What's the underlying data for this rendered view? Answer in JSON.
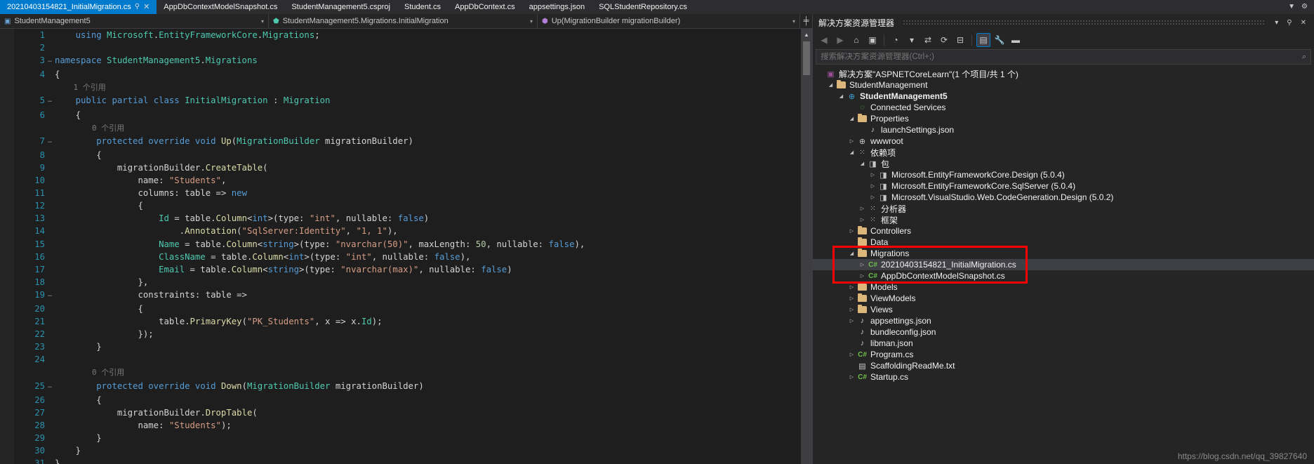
{
  "tabs": [
    {
      "label": "20210403154821_InitialMigration.cs",
      "active": true,
      "pin": "⚲",
      "close": "✕"
    },
    {
      "label": "AppDbContextModelSnapshot.cs",
      "active": false
    },
    {
      "label": "StudentManagement5.csproj",
      "active": false
    },
    {
      "label": "Student.cs",
      "active": false
    },
    {
      "label": "AppDbContext.cs",
      "active": false
    },
    {
      "label": "appsettings.json",
      "active": false
    },
    {
      "label": "SQLStudentRepository.cs",
      "active": false
    }
  ],
  "tab_controls": {
    "dropdown": "▼",
    "gear": "⚙"
  },
  "navbar": {
    "project": "StudentManagement5",
    "type": "StudentManagement5.Migrations.InitialMigration",
    "member": "Up(MigrationBuilder migrationBuilder)",
    "caret": "▾",
    "split": "╪"
  },
  "editor": {
    "scroll": {
      "up": "▲",
      "down": "▼"
    },
    "lines": [
      {
        "n": "1",
        "fold": "",
        "text": "    using Microsoft.EntityFrameworkCore.Migrations;"
      },
      {
        "n": "2",
        "fold": "",
        "text": ""
      },
      {
        "n": "3",
        "fold": "−",
        "text": "namespace StudentManagement5.Migrations"
      },
      {
        "n": "4",
        "fold": "",
        "text": "{"
      },
      {
        "n": "",
        "fold": "",
        "text": "    1 个引用"
      },
      {
        "n": "5",
        "fold": "−",
        "text": "    public partial class InitialMigration : Migration"
      },
      {
        "n": "6",
        "fold": "",
        "text": "    {"
      },
      {
        "n": "",
        "fold": "",
        "text": "        0 个引用"
      },
      {
        "n": "7",
        "fold": "−",
        "text": "        protected override void Up(MigrationBuilder migrationBuilder)"
      },
      {
        "n": "8",
        "fold": "",
        "text": "        {"
      },
      {
        "n": "9",
        "fold": "",
        "text": "            migrationBuilder.CreateTable("
      },
      {
        "n": "10",
        "fold": "",
        "text": "                name: \"Students\","
      },
      {
        "n": "11",
        "fold": "",
        "text": "                columns: table => new"
      },
      {
        "n": "12",
        "fold": "",
        "text": "                {"
      },
      {
        "n": "13",
        "fold": "",
        "text": "                    Id = table.Column<int>(type: \"int\", nullable: false)"
      },
      {
        "n": "14",
        "fold": "",
        "text": "                        .Annotation(\"SqlServer:Identity\", \"1, 1\"),"
      },
      {
        "n": "15",
        "fold": "",
        "text": "                    Name = table.Column<string>(type: \"nvarchar(50)\", maxLength: 50, nullable: false),"
      },
      {
        "n": "16",
        "fold": "",
        "text": "                    ClassName = table.Column<int>(type: \"int\", nullable: false),"
      },
      {
        "n": "17",
        "fold": "",
        "text": "                    Email = table.Column<string>(type: \"nvarchar(max)\", nullable: false)"
      },
      {
        "n": "18",
        "fold": "",
        "text": "                },"
      },
      {
        "n": "19",
        "fold": "−",
        "text": "                constraints: table =>"
      },
      {
        "n": "20",
        "fold": "",
        "text": "                {"
      },
      {
        "n": "21",
        "fold": "",
        "text": "                    table.PrimaryKey(\"PK_Students\", x => x.Id);"
      },
      {
        "n": "22",
        "fold": "",
        "text": "                });"
      },
      {
        "n": "23",
        "fold": "",
        "text": "        }"
      },
      {
        "n": "24",
        "fold": "",
        "text": ""
      },
      {
        "n": "",
        "fold": "",
        "text": "        0 个引用"
      },
      {
        "n": "25",
        "fold": "−",
        "text": "        protected override void Down(MigrationBuilder migrationBuilder)"
      },
      {
        "n": "26",
        "fold": "",
        "text": "        {"
      },
      {
        "n": "27",
        "fold": "",
        "text": "            migrationBuilder.DropTable("
      },
      {
        "n": "28",
        "fold": "",
        "text": "                name: \"Students\");"
      },
      {
        "n": "29",
        "fold": "",
        "text": "        }"
      },
      {
        "n": "30",
        "fold": "",
        "text": "    }"
      },
      {
        "n": "31",
        "fold": "",
        "text": "}"
      }
    ]
  },
  "solution_explorer": {
    "title": "解决方案资源管理器",
    "title_buttons": {
      "dropdown": "▾",
      "pin": "⚲",
      "close": "✕"
    },
    "toolbar": [
      {
        "name": "back",
        "glyph": "◀"
      },
      {
        "name": "forward",
        "glyph": "▶"
      },
      {
        "name": "home",
        "glyph": "⌂"
      },
      {
        "name": "switch-views",
        "glyph": "▣"
      },
      {
        "name": "pending-changes",
        "glyph": "◔"
      },
      {
        "name": "pending-changes-dropdown",
        "glyph": "▾"
      },
      {
        "name": "sync-with-active-document",
        "glyph": "⇄"
      },
      {
        "name": "refresh",
        "glyph": "⟳"
      },
      {
        "name": "collapse-all",
        "glyph": "⊟"
      },
      {
        "name": "show-all-files",
        "glyph": "▤"
      },
      {
        "name": "properties",
        "glyph": "🔧"
      },
      {
        "name": "preview-selected-items",
        "glyph": "▬"
      }
    ],
    "search_placeholder": "搜索解决方案资源管理器(Ctrl+;)",
    "search_value": "",
    "search_icon": "⌕",
    "tree": [
      {
        "indent": 0,
        "twisty": "",
        "icon": "sln",
        "label": "解决方案\"ASPNETCoreLearn\"(1 个项目/共 1 个)",
        "bold": false,
        "selected": false
      },
      {
        "indent": 1,
        "twisty": "◢",
        "icon": "folder",
        "label": "StudentManagement",
        "bold": false,
        "selected": false
      },
      {
        "indent": 2,
        "twisty": "◢",
        "icon": "proj",
        "label": "StudentManagement5",
        "bold": true,
        "selected": false
      },
      {
        "indent": 3,
        "twisty": "",
        "icon": "conn",
        "label": "Connected Services",
        "bold": false,
        "selected": false
      },
      {
        "indent": 3,
        "twisty": "◢",
        "icon": "props",
        "label": "Properties",
        "bold": false,
        "selected": false
      },
      {
        "indent": 4,
        "twisty": "",
        "icon": "json",
        "label": "launchSettings.json",
        "bold": false,
        "selected": false
      },
      {
        "indent": 3,
        "twisty": "▷",
        "icon": "www",
        "label": "wwwroot",
        "bold": false,
        "selected": false
      },
      {
        "indent": 3,
        "twisty": "◢",
        "icon": "dep",
        "label": "依赖项",
        "bold": false,
        "selected": false
      },
      {
        "indent": 4,
        "twisty": "◢",
        "icon": "pkg",
        "label": "包",
        "bold": false,
        "selected": false
      },
      {
        "indent": 5,
        "twisty": "▷",
        "icon": "pkg",
        "label": "Microsoft.EntityFrameworkCore.Design (5.0.4)",
        "bold": false,
        "selected": false
      },
      {
        "indent": 5,
        "twisty": "▷",
        "icon": "pkg",
        "label": "Microsoft.EntityFrameworkCore.SqlServer (5.0.4)",
        "bold": false,
        "selected": false
      },
      {
        "indent": 5,
        "twisty": "▷",
        "icon": "pkg",
        "label": "Microsoft.VisualStudio.Web.CodeGeneration.Design (5.0.2)",
        "bold": false,
        "selected": false
      },
      {
        "indent": 4,
        "twisty": "▷",
        "icon": "dep",
        "label": "分析器",
        "bold": false,
        "selected": false
      },
      {
        "indent": 4,
        "twisty": "▷",
        "icon": "dep",
        "label": "框架",
        "bold": false,
        "selected": false
      },
      {
        "indent": 3,
        "twisty": "▷",
        "icon": "folder",
        "label": "Controllers",
        "bold": false,
        "selected": false
      },
      {
        "indent": 3,
        "twisty": "",
        "icon": "folder",
        "label": "Data",
        "bold": false,
        "selected": false
      },
      {
        "indent": 3,
        "twisty": "◢",
        "icon": "folder",
        "label": "Migrations",
        "bold": false,
        "selected": false
      },
      {
        "indent": 4,
        "twisty": "▷",
        "icon": "cs",
        "label": "20210403154821_InitialMigration.cs",
        "bold": false,
        "selected": true
      },
      {
        "indent": 4,
        "twisty": "▷",
        "icon": "cs",
        "label": "AppDbContextModelSnapshot.cs",
        "bold": false,
        "selected": false
      },
      {
        "indent": 3,
        "twisty": "▷",
        "icon": "folder",
        "label": "Models",
        "bold": false,
        "selected": false
      },
      {
        "indent": 3,
        "twisty": "▷",
        "icon": "folder",
        "label": "ViewModels",
        "bold": false,
        "selected": false
      },
      {
        "indent": 3,
        "twisty": "▷",
        "icon": "folder",
        "label": "Views",
        "bold": false,
        "selected": false
      },
      {
        "indent": 3,
        "twisty": "▷",
        "icon": "json",
        "label": "appsettings.json",
        "bold": false,
        "selected": false
      },
      {
        "indent": 3,
        "twisty": "",
        "icon": "json",
        "label": "bundleconfig.json",
        "bold": false,
        "selected": false
      },
      {
        "indent": 3,
        "twisty": "",
        "icon": "json",
        "label": "libman.json",
        "bold": false,
        "selected": false
      },
      {
        "indent": 3,
        "twisty": "▷",
        "icon": "cs",
        "label": "Program.cs",
        "bold": false,
        "selected": false
      },
      {
        "indent": 3,
        "twisty": "",
        "icon": "txt",
        "label": "ScaffoldingReadMe.txt",
        "bold": false,
        "selected": false
      },
      {
        "indent": 3,
        "twisty": "▷",
        "icon": "cs",
        "label": "Startup.cs",
        "bold": false,
        "selected": false
      }
    ]
  },
  "annotation": {
    "highlight_color": "#ff0000"
  },
  "watermark": "https://blog.csdn.net/qq_39827640"
}
